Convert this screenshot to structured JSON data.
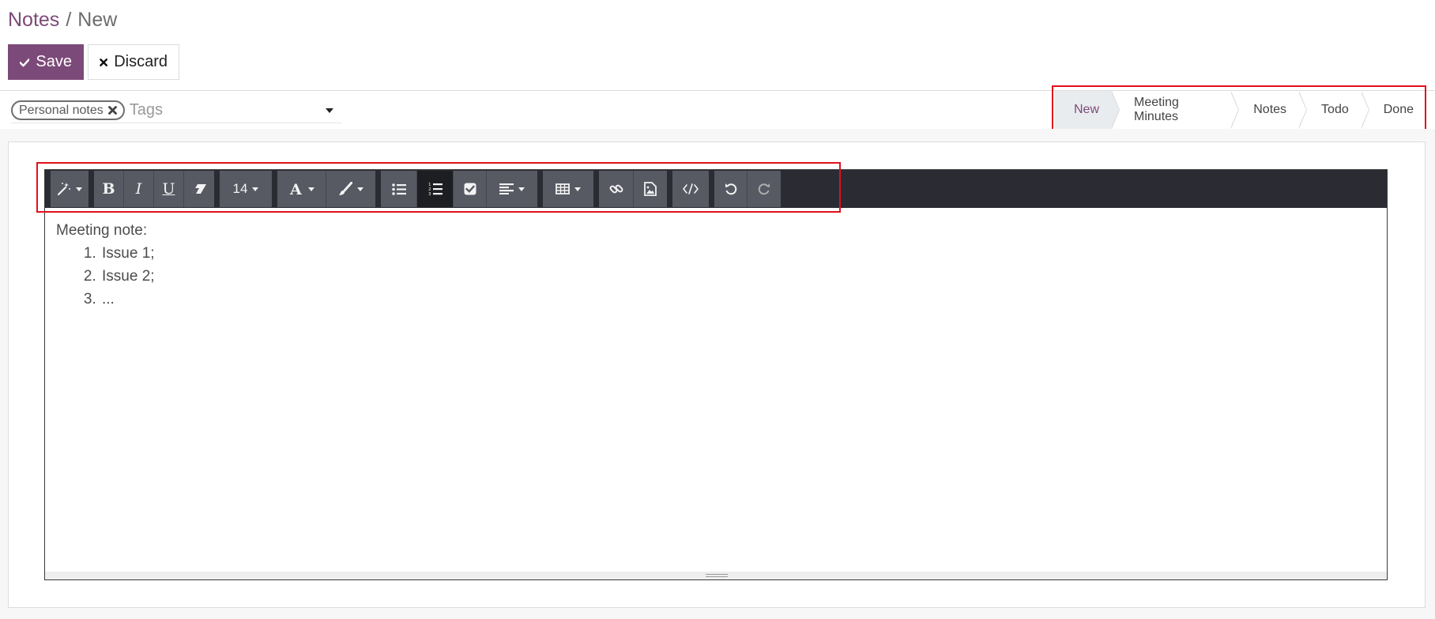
{
  "breadcrumb": {
    "root": "Notes",
    "separator": "/",
    "current": "New"
  },
  "actions": {
    "save_label": "Save",
    "discard_label": "Discard"
  },
  "tags": {
    "selected": [
      "Personal notes"
    ],
    "placeholder": "Tags"
  },
  "statusbar": {
    "stages": [
      "New",
      "Meeting Minutes",
      "Notes",
      "Todo",
      "Done"
    ],
    "active": "New"
  },
  "toolbar": {
    "font_size": "14",
    "groups": [
      [
        "magic-wand-icon"
      ],
      [
        "bold-icon",
        "italic-icon",
        "underline-icon",
        "eraser-icon"
      ],
      [
        "font-size"
      ],
      [
        "font-color-icon",
        "highlight-brush-icon"
      ],
      [
        "bullet-list-icon",
        "numbered-list-icon",
        "checklist-icon",
        "align-icon"
      ],
      [
        "table-icon"
      ],
      [
        "link-icon",
        "image-icon"
      ],
      [
        "code-view-icon"
      ],
      [
        "undo-icon",
        "redo-icon"
      ]
    ],
    "active_button": "numbered-list-icon"
  },
  "editor": {
    "heading": "Meeting note:",
    "items": [
      "Issue 1;",
      "Issue 2;",
      "..."
    ]
  },
  "colors": {
    "brand": "#7c4a78",
    "toolbar_bg": "#2b2c33",
    "toolbar_button": "#575963",
    "highlight_box": "#e0111b"
  }
}
